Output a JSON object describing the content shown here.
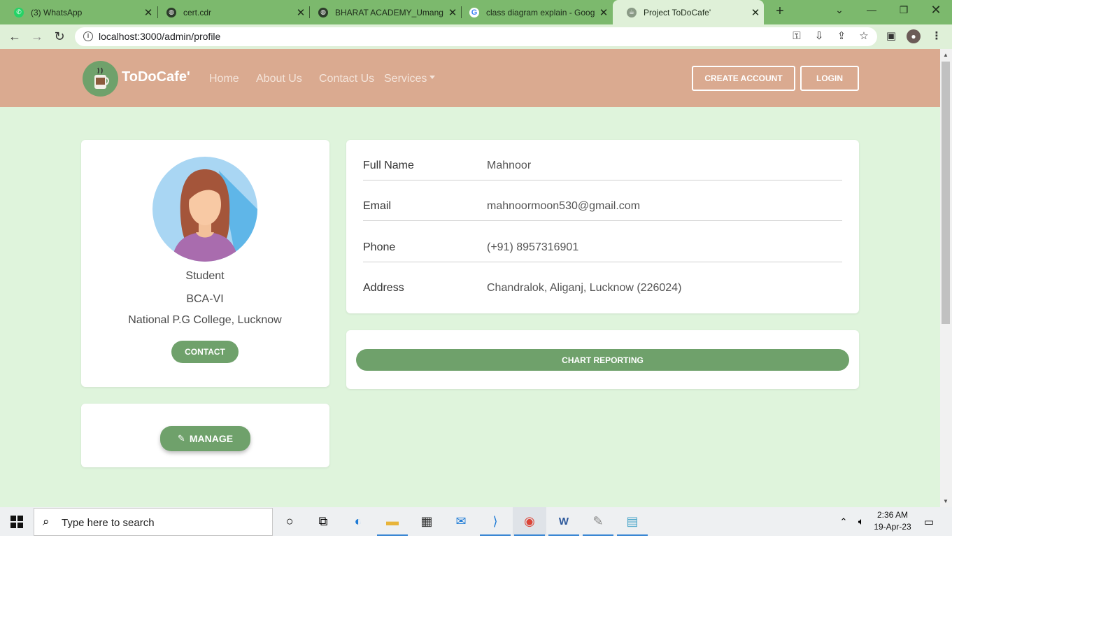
{
  "browser": {
    "tabs": [
      {
        "title": "(3) WhatsApp",
        "icon": "whatsapp-icon",
        "active": false
      },
      {
        "title": "cert.cdr",
        "icon": "globe-icon",
        "active": false
      },
      {
        "title": "BHARAT ACADEMY_Umang S",
        "icon": "globe-icon",
        "active": false
      },
      {
        "title": "class diagram explain - Goog",
        "icon": "google-icon",
        "active": false
      },
      {
        "title": "Project ToDoCafe'",
        "icon": "todocafe-icon",
        "active": true
      }
    ],
    "url": "localhost:3000/admin/profile"
  },
  "navbar": {
    "brand": "ToDoCafe'",
    "links": [
      "Home",
      "About Us",
      "Contact Us",
      "Services"
    ],
    "create_account": "CREATE ACCOUNT",
    "login": "LOGIN"
  },
  "profile": {
    "role": "Student",
    "course": "BCA-VI",
    "college": "National P.G College, Lucknow",
    "contact_button": "CONTACT",
    "manage_button": "MANAGE"
  },
  "details": [
    {
      "label": "Full Name",
      "value": "Mahnoor"
    },
    {
      "label": "Email",
      "value": "mahnoormoon530@gmail.com"
    },
    {
      "label": "Phone",
      "value": "(+91) 8957316901"
    },
    {
      "label": "Address",
      "value": "Chandralok, Aliganj, Lucknow (226024)"
    }
  ],
  "chart_button": "CHART REPORTING",
  "taskbar": {
    "search_placeholder": "Type here to search",
    "time": "2:36 AM",
    "date": "19-Apr-23"
  },
  "colors": {
    "tab_strip": "#7cb96d",
    "navbar": "#daaa90",
    "page_bg": "#dff4dc",
    "accent": "#6fa16b"
  }
}
